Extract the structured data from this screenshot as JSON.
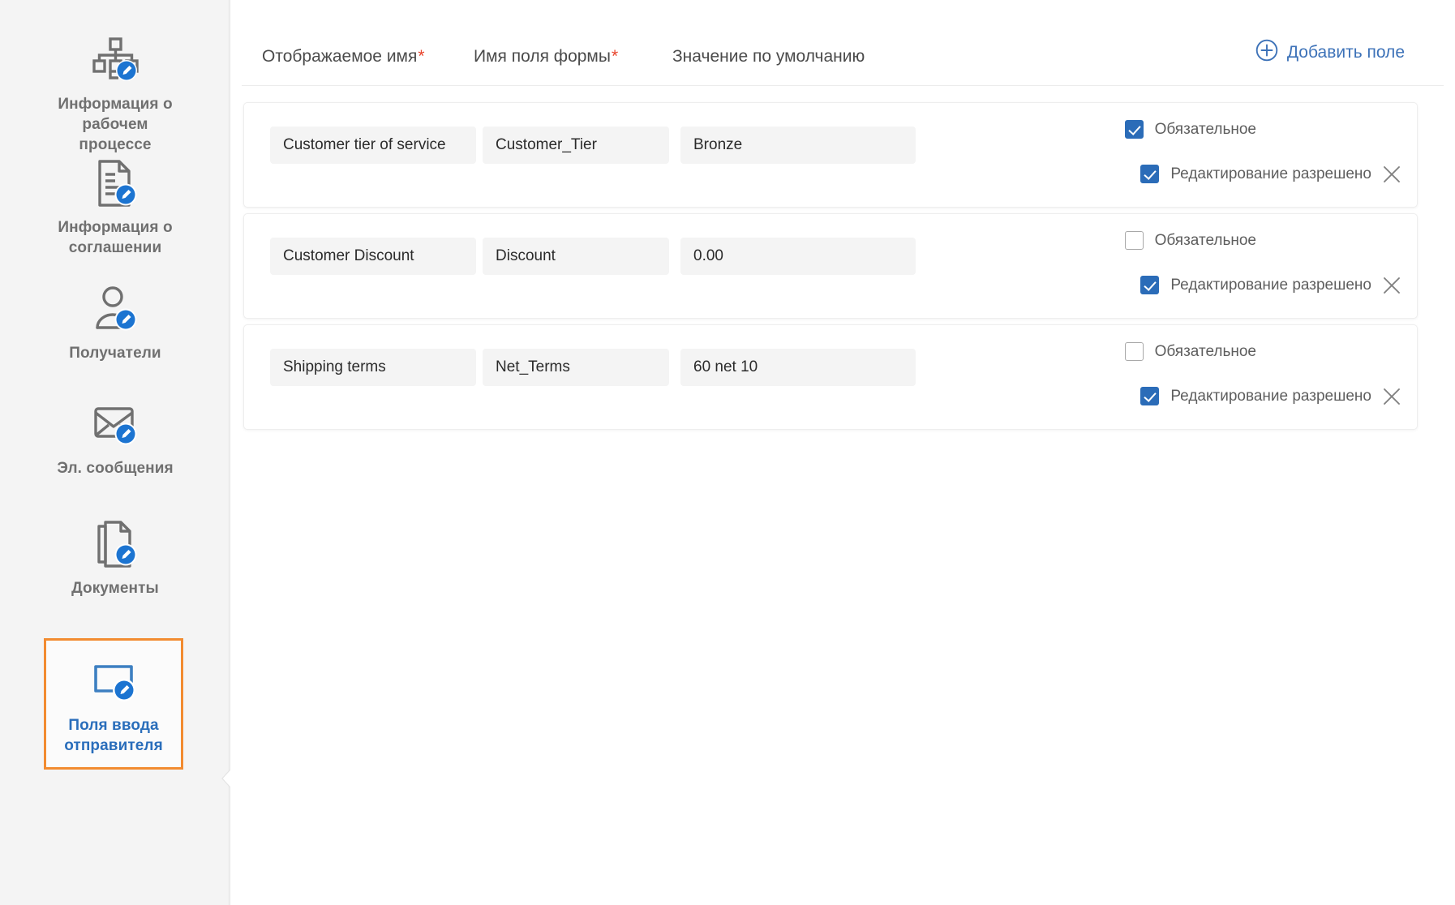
{
  "sidebar": {
    "items": [
      {
        "label": "Информация о\nрабочем процессе",
        "icon": "workflow-info-icon",
        "selected": false
      },
      {
        "label": "Информация о\nсоглашении",
        "icon": "agreement-info-icon",
        "selected": false
      },
      {
        "label": "Получатели",
        "icon": "recipients-icon",
        "selected": false
      },
      {
        "label": "Эл. сообщения",
        "icon": "emails-icon",
        "selected": false
      },
      {
        "label": "Документы",
        "icon": "documents-icon",
        "selected": false
      },
      {
        "label": "Поля ввода\nотправителя",
        "icon": "sender-input-fields-icon",
        "selected": true
      }
    ],
    "selected_border_color": "#f28b30",
    "selected_text_color": "#2a6ebb",
    "background": "#f4f4f4"
  },
  "header": {
    "columns": [
      {
        "label": "Отображаемое имя",
        "required": true
      },
      {
        "label": "Имя поля формы",
        "required": true
      },
      {
        "label": "Значение по умолчанию",
        "required": false
      }
    ],
    "required_marker": "*",
    "required_marker_color": "#e8442c",
    "add_field_label": "Добавить поле",
    "add_field_icon": "plus-circle-icon",
    "link_color": "#3d72b8"
  },
  "labels": {
    "required_checkbox": "Обязательное",
    "editable_checkbox": "Редактирование разрешено",
    "remove_icon": "close-x-icon"
  },
  "rows": [
    {
      "display_name": "Customer tier of service",
      "form_field_name": "Customer_Tier",
      "default_value": "Bronze",
      "required": true,
      "editable": true
    },
    {
      "display_name": "Customer Discount",
      "form_field_name": "Discount",
      "default_value": "0.00",
      "required": false,
      "editable": true
    },
    {
      "display_name": "Shipping terms",
      "form_field_name": "Net_Terms",
      "default_value": "60 net 10",
      "required": false,
      "editable": true
    }
  ],
  "colors": {
    "checkbox_checked": "#2b6cb8",
    "input_background": "#f4f4f4",
    "accent_orange": "#f28b30"
  }
}
